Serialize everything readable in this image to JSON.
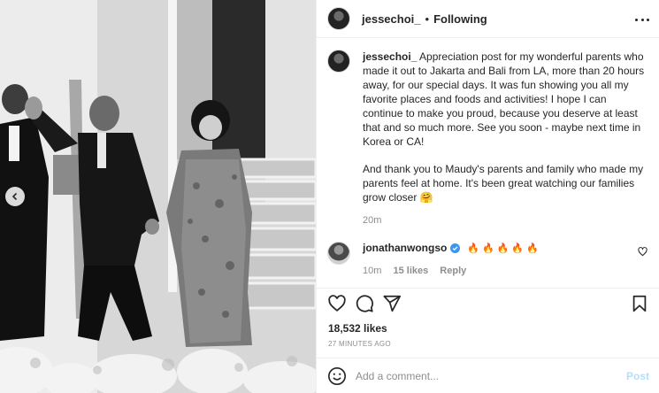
{
  "post": {
    "username": "jessechoi_",
    "separator": "•",
    "follow_status": "Following",
    "more_icon": "more-horizontal-icon"
  },
  "caption": {
    "username": "jessechoi_",
    "paragraph1": "Appreciation post for my wonderful parents who made it out to Jakarta and Bali from LA, more than 20 hours away, for our special days. It was fun showing you all my favorite places and foods and activities! I hope I can continue to make you proud, because you deserve at least that and so much more. See you soon - maybe next time in Korea or CA!",
    "paragraph2": "And thank you to Maudy's parents and family who made my parents feel at home. It's been great watching our families grow closer 🤗",
    "time": "20m"
  },
  "comments": [
    {
      "username": "jonathanwongso",
      "verified": true,
      "text": "🔥🔥🔥🔥🔥",
      "time": "10m",
      "likes": "15 likes",
      "reply": "Reply"
    }
  ],
  "actions": {
    "icons": [
      "heart-icon",
      "comment-icon",
      "share-icon",
      "bookmark-icon"
    ]
  },
  "likes": "18,532 likes",
  "posted_time": "27 MINUTES AGO",
  "add_comment": {
    "placeholder": "Add a comment...",
    "post_label": "Post",
    "emoji_icon": "emoji-icon"
  },
  "colors": {
    "link_disabled": "#b2dffc",
    "verified": "#3897f0",
    "secondary_text": "#8e8e8e",
    "border": "#efefef"
  }
}
